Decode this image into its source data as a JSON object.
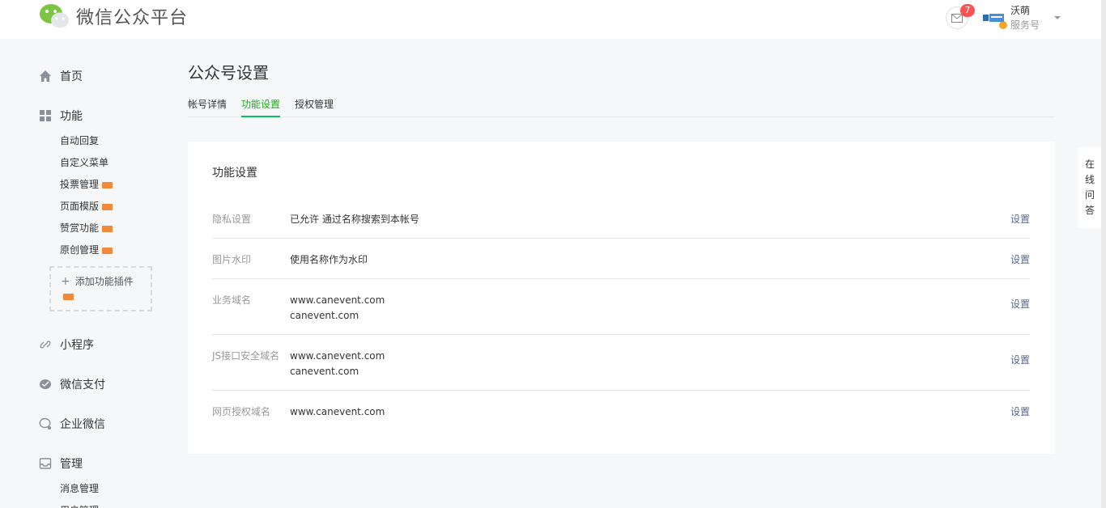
{
  "header": {
    "app_title": "微信公众平台",
    "mail_count": "7",
    "account_name": "沃萌",
    "account_type": "服务号"
  },
  "sidebar": {
    "home": "首页",
    "features": {
      "label": "功能",
      "items": [
        {
          "label": "自动回复",
          "new": false
        },
        {
          "label": "自定义菜单",
          "new": false
        },
        {
          "label": "投票管理",
          "new": true
        },
        {
          "label": "页面模版",
          "new": true
        },
        {
          "label": "赞赏功能",
          "new": true
        },
        {
          "label": "原创管理",
          "new": true
        }
      ],
      "add_plugin": "添加功能插件"
    },
    "miniprogram": "小程序",
    "wechat_pay": "微信支付",
    "wecom": "企业微信",
    "manage": {
      "label": "管理",
      "items": [
        "消息管理",
        "用户管理"
      ]
    }
  },
  "main": {
    "page_title": "公众号设置",
    "tabs": [
      "帐号详情",
      "功能设置",
      "授权管理"
    ],
    "active_tab": "功能设置",
    "card_title": "功能设置",
    "rows": [
      {
        "label": "隐私设置",
        "values": [
          "已允许 通过名称搜索到本帐号"
        ],
        "action": "设置"
      },
      {
        "label": "图片水印",
        "values": [
          "使用名称作为水印"
        ],
        "action": "设置"
      },
      {
        "label": "业务域名",
        "values": [
          "www.canevent.com",
          "canevent.com"
        ],
        "action": "设置"
      },
      {
        "label": "JS接口安全域名",
        "values": [
          "www.canevent.com",
          "canevent.com"
        ],
        "action": "设置"
      },
      {
        "label": "网页授权域名",
        "values": [
          "www.canevent.com"
        ],
        "action": "设置"
      }
    ]
  },
  "float_help": [
    "在",
    "线",
    "问",
    "答"
  ],
  "colors": {
    "accent_green": "#07c160",
    "link": "#576b95",
    "badge_red": "#f95353",
    "new_tag": "#ef8a3b",
    "bg": "#f6f7f9"
  }
}
